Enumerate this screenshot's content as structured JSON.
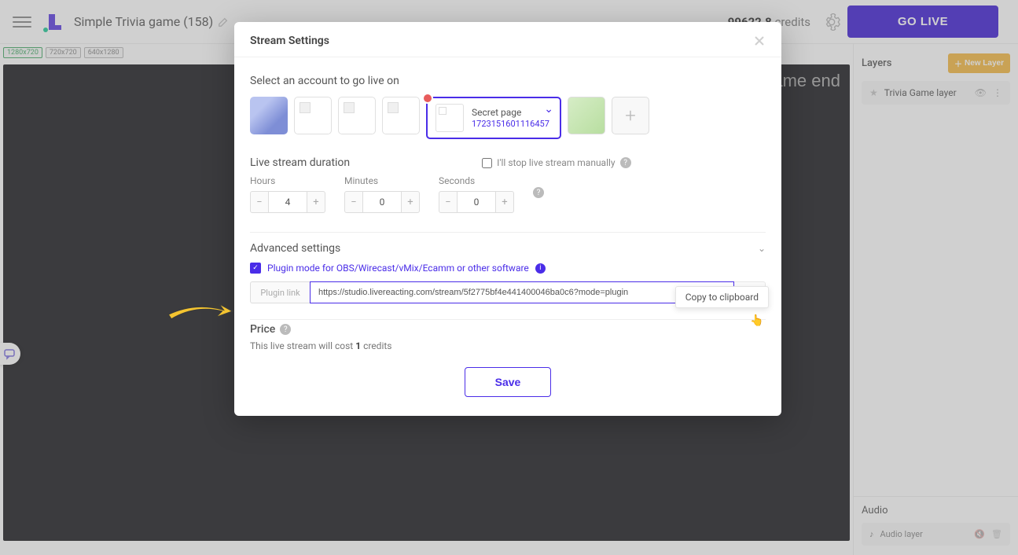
{
  "topbar": {
    "project_name": "Simple Trivia game (158)",
    "credits_value": "99622.8",
    "credits_label": "credits",
    "go_live": "GO LIVE"
  },
  "resolutions": [
    "1280x720",
    "720x720",
    "640x1280"
  ],
  "preview": {
    "label": "ame end"
  },
  "rightPanel": {
    "layers_title": "Layers",
    "new_layer": "New Layer",
    "layer_name": "Trivia Game layer",
    "audio_title": "Audio",
    "audio_layer": "Audio layer"
  },
  "modal": {
    "title": "Stream Settings",
    "select_account": "Select an account to go live on",
    "account": {
      "name": "Secret page",
      "id": "1723151601116457"
    },
    "duration_title": "Live stream duration",
    "stop_manual": "I'll stop live stream manually",
    "hours_label": "Hours",
    "hours_val": "4",
    "minutes_label": "Minutes",
    "minutes_val": "0",
    "seconds_label": "Seconds",
    "seconds_val": "0",
    "adv_title": "Advanced settings",
    "plugin_label": "Plugin mode for OBS/Wirecast/vMix/Ecamm or other software",
    "plugin_link_label": "Plugin link",
    "plugin_link": "https://studio.livereacting.com/stream/5f2775bf4e441400046ba0c6?mode=plugin",
    "tooltip": "Copy to clipboard",
    "price_title": "Price",
    "price_prefix": "This live stream will cost ",
    "price_val": "1",
    "price_suffix": " credits",
    "save": "Save"
  }
}
